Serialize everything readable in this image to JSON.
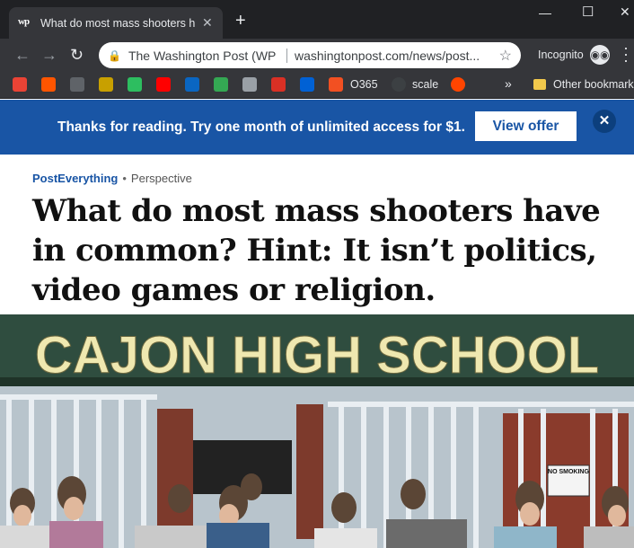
{
  "browser": {
    "tab": {
      "favicon_text": "wp",
      "title": "What do most mass shooters have in common? Hint: It isn't politics, video games or religion."
    },
    "omnibox": {
      "site_name": "The Washington Post (WP C",
      "url": "washingtonpost.com/news/post..."
    },
    "profile_label": "Incognito",
    "bookmarks": [
      {
        "icon": "gmail-icon",
        "color": "#ea4335"
      },
      {
        "icon": "soundcloud-icon",
        "color": "#ff5500"
      },
      {
        "icon": "bookmark-icon-dark",
        "color": "#5f6368"
      },
      {
        "icon": "bee-icon",
        "color": "#c8a000"
      },
      {
        "icon": "evernote-icon",
        "color": "#2dbe60"
      },
      {
        "icon": "youtube-icon",
        "color": "#ff0000"
      },
      {
        "icon": "linkedin-icon",
        "color": "#0a66c2"
      },
      {
        "icon": "maps-icon",
        "color": "#34a853"
      },
      {
        "icon": "drive-icon",
        "color": "#9aa0a6"
      },
      {
        "icon": "news-icon",
        "color": "#d93025"
      },
      {
        "icon": "box-icon",
        "color": "#0061d5"
      },
      {
        "icon": "microsoft-icon",
        "color": "#f25022"
      }
    ],
    "bookmark_o365": "O365",
    "bookmark_scale": "scale",
    "other_bookmarks": "Other bookmarks"
  },
  "banner": {
    "message": "Thanks for reading. Try one month of unlimited access for $1.",
    "button_label": "View offer",
    "close_glyph": "✕"
  },
  "article": {
    "section": "PostEverything",
    "separator": "•",
    "type": "Perspective",
    "headline": "What do most mass shooters have in common? Hint: It isn’t politics, video games or religion."
  },
  "photo": {
    "sign_text": "CAJON HIGH SCHOOL",
    "small_sign": "NO SMOKING"
  }
}
